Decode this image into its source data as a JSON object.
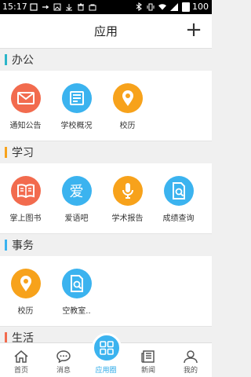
{
  "status_bar": {
    "time": "15:17",
    "battery": "100"
  },
  "header": {
    "title": "应用",
    "add_label": "+"
  },
  "sections": [
    {
      "title": "办公",
      "accent": "#2bb5c9",
      "apps": [
        {
          "label": "通知公告",
          "icon": "envelope-icon",
          "color": "#f26b4e"
        },
        {
          "label": "学校概况",
          "icon": "newspaper-icon",
          "color": "#3bb3ef"
        },
        {
          "label": "校历",
          "icon": "location-pin-icon",
          "color": "#f7a21b"
        }
      ]
    },
    {
      "title": "学习",
      "accent": "#f7a21b",
      "apps": [
        {
          "label": "掌上图书",
          "icon": "book-icon",
          "color": "#f26b4e"
        },
        {
          "label": "爱语吧",
          "icon": "ai-char-icon",
          "color": "#3bb3ef"
        },
        {
          "label": "学术报告",
          "icon": "microphone-icon",
          "color": "#f7a21b"
        },
        {
          "label": "成绩查询",
          "icon": "document-search-icon",
          "color": "#3bb3ef"
        }
      ]
    },
    {
      "title": "事务",
      "accent": "#3bb3ef",
      "apps": [
        {
          "label": "校历",
          "icon": "location-pin-icon",
          "color": "#f7a21b"
        },
        {
          "label": "空教室..",
          "icon": "document-search-icon",
          "color": "#3bb3ef"
        }
      ]
    },
    {
      "title": "生活",
      "accent": "#f26b4e",
      "apps": []
    }
  ],
  "bottom_nav": {
    "items": [
      {
        "label": "首页",
        "icon": "home-icon"
      },
      {
        "label": "消息",
        "icon": "chat-bubble-icon"
      },
      {
        "label": "应用圈",
        "icon": "grid-icon"
      },
      {
        "label": "新闻",
        "icon": "newspaper-icon"
      },
      {
        "label": "我的",
        "icon": "person-icon"
      }
    ],
    "active_index": 2,
    "active_color": "#29a8e8"
  },
  "ai_char": "爱"
}
